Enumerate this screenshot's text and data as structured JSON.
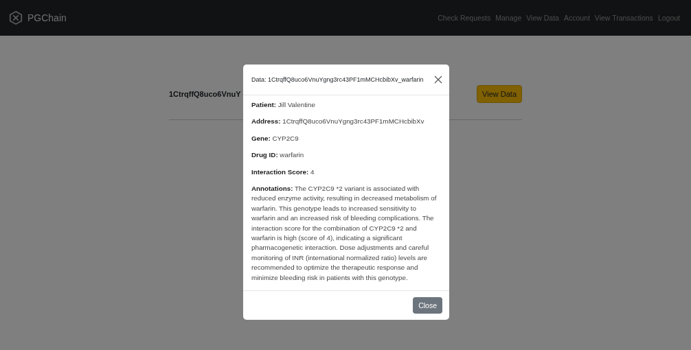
{
  "navbar": {
    "brand": "PGChain",
    "links": [
      "Check Requests",
      "Manage",
      "View Data",
      "Account",
      "View Transactions",
      "Logout"
    ]
  },
  "page": {
    "rows": [
      {
        "address": "1CtrqffQ8uco6VnuY",
        "button": "View Data"
      }
    ]
  },
  "modal": {
    "title": "Data: 1CtrqffQ8uco6VnuYgng3rc43PF1mMCHcbibXv_warfarin",
    "fields": [
      "**Patient:** Jill Valentine",
      "**Address:** 1CtrqffQ8uco6VnuYgng3rc43PF1mMCHcbibXv",
      "**Gene:** CYP2C9",
      "**Drug ID:** warfarin",
      "**Interaction Score:** 4",
      "**Annotations:** The CYP2C9 *2 variant is associated with reduced enzyme activity, resulting in decreased metabolism of warfarin. This genotype leads to increased sensitivity to warfarin and an increased risk of bleeding complications. The interaction score for the combination of CYP2C9 *2 and warfarin is high (score of 4), indicating a significant pharmacogenetic interaction. Dose adjustments and careful monitoring of INR (international normalized ratio) levels are recommended to optimize the therapeutic response and minimize bleeding risk in patients with this genotype."
    ],
    "close_button": "Close"
  }
}
